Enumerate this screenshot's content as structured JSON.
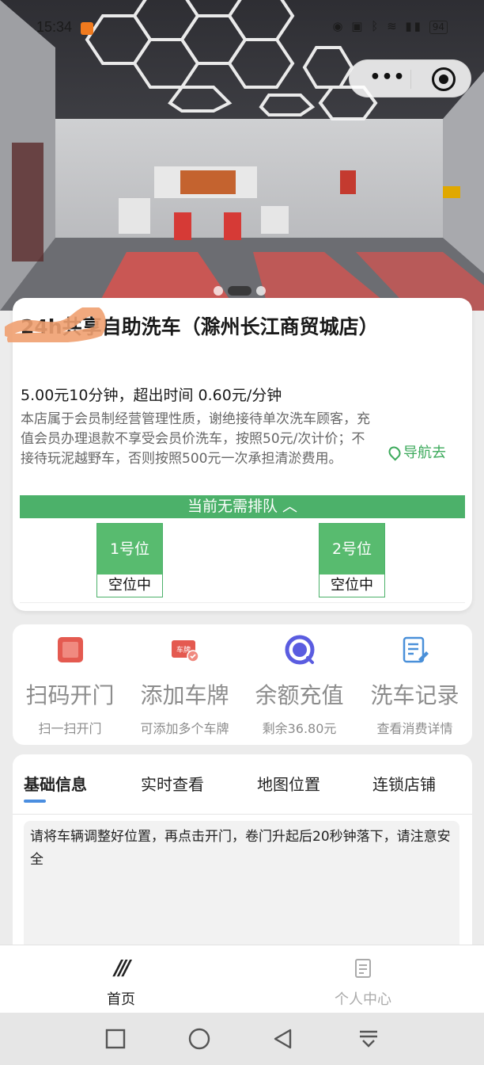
{
  "status_bar": {
    "time": "15:34",
    "battery": "94"
  },
  "miniprogram_capsule": {
    "more": "•••"
  },
  "store": {
    "title": "24h共享自助洗车（滁州长江商贸城店）",
    "price": "5.00元10分钟，超出时间 0.60元/分钟",
    "description": "本店属于会员制经营管理性质，谢绝接待单次洗车顾客，充值会员办理退款不享受会员价洗车，按照50元/次计价；不接待玩泥越野车，否则按照500元一次承担清淤费用。",
    "navigate": "导航去"
  },
  "queue_status": "当前无需排队 ︿",
  "bays": [
    {
      "number": "1号位",
      "status": "空位中"
    },
    {
      "number": "2号位",
      "status": "空位中"
    }
  ],
  "actions": [
    {
      "label": "扫码开门",
      "sub": "扫一扫开门",
      "icon": "scan-door-icon",
      "color": "#e45a50"
    },
    {
      "label": "添加车牌",
      "sub": "可添加多个车牌",
      "icon": "license-plate-icon",
      "color": "#e45a50",
      "badge": "车牌"
    },
    {
      "label": "余额充值",
      "sub": "剩余36.80元",
      "icon": "balance-icon",
      "color": "#5a5ce0"
    },
    {
      "label": "洗车记录",
      "sub": "查看消费详情",
      "icon": "record-icon",
      "color": "#4a90d9"
    }
  ],
  "tabs": [
    "基础信息",
    "实时查看",
    "地图位置",
    "连锁店铺"
  ],
  "active_tab": 0,
  "notice": "请将车辆调整好位置，再点击开门，卷门升起后20秒钟落下，请注意安全",
  "bottom_nav": [
    {
      "label": "首页",
      "icon": "home-icon",
      "active": true
    },
    {
      "label": "个人中心",
      "icon": "profile-icon",
      "active": false
    }
  ],
  "colors": {
    "accent_green": "#4cb16a",
    "tab_indicator": "#4a8ee0"
  }
}
